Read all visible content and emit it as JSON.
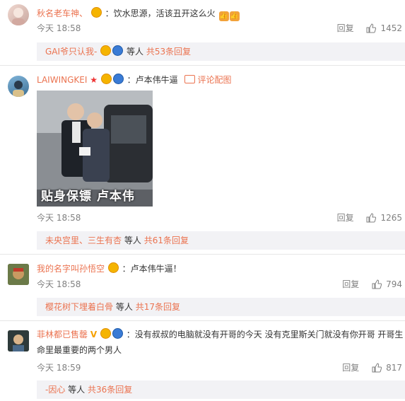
{
  "comments": [
    {
      "user": "秋名老车神、",
      "text": "：饮水思源，活该丑开这么火",
      "time": "今天 18:58",
      "reply_label": "回复",
      "likes": "1452",
      "reply_summary": {
        "names": "GAI爷只认我-",
        "middle": "等人",
        "count": "共53条回复"
      }
    },
    {
      "user": "LAIWINGKEI",
      "text": "：卢本伟牛逼",
      "pic_link": "评论配图",
      "caption": "贴身保镖 卢本伟",
      "time": "今天 18:58",
      "reply_label": "回复",
      "likes": "1265",
      "reply_summary": {
        "names": "未央宫里、三生有杏",
        "middle": "等人",
        "count": "共61条回复"
      }
    },
    {
      "user": "我的名字叫孙悟空",
      "text": "：卢本伟牛逼！",
      "time": "今天 18:58",
      "reply_label": "回复",
      "likes": "794",
      "reply_summary": {
        "names": "樱花树下埋着白骨",
        "middle": "等人",
        "count": "共17条回复"
      }
    },
    {
      "user": "菲林都已售罄",
      "text_line1": "：没有叔叔的电脑就没有开哥的今天 没有克里斯关门就没有你开哥 开哥生",
      "text_line2": "命里最重要的两个男人",
      "time": "今天 18:59",
      "reply_label": "回复",
      "likes": "817",
      "reply_summary": {
        "names": "-因心",
        "middle": "等人",
        "count": "共36条回复"
      }
    }
  ],
  "icons": [
    "vip-crown-icon",
    "level-badge-icon",
    "thumbs-up-icon",
    "like-icon",
    "image-icon",
    "verified-v-icon",
    "star-icon"
  ],
  "colors": {
    "accent": "#eb7350",
    "meta": "#808080",
    "reply_bg": "#f2f2f5"
  }
}
